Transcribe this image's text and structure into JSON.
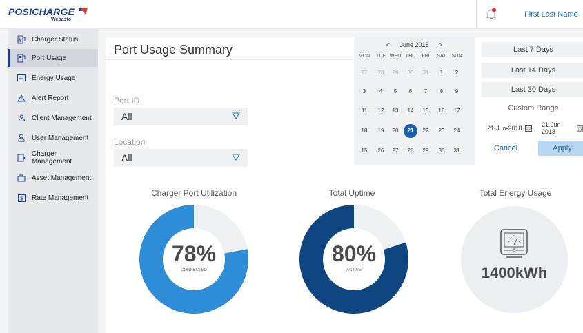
{
  "header": {
    "brand": "POSICHARGE",
    "brand_sub": "Webasto",
    "user_name": "First Last Name",
    "icons": {
      "notifications": "bell-icon"
    }
  },
  "sidebar": {
    "items": [
      {
        "label": "Charger Status",
        "icon": "charger-status-icon"
      },
      {
        "label": "Port Usage",
        "icon": "port-usage-icon",
        "active": true
      },
      {
        "label": "Energy Usage",
        "icon": "energy-usage-icon"
      },
      {
        "label": "Alert Report",
        "icon": "alert-icon"
      },
      {
        "label": "Client Management",
        "icon": "client-icon"
      },
      {
        "label": "User Management",
        "icon": "user-icon"
      },
      {
        "label": "Charger Management",
        "icon": "charger-management-icon"
      },
      {
        "label": "Asset Management",
        "icon": "asset-icon"
      },
      {
        "label": "Rate Management",
        "icon": "rate-icon"
      }
    ]
  },
  "main": {
    "title": "Port Usage Summary",
    "filters": {
      "port_id_label": "Port ID",
      "port_id_value": "All",
      "location_label": "Location",
      "location_value": "All"
    }
  },
  "calendar": {
    "prev": "<",
    "month": "June 2018",
    "next": ">",
    "dow": [
      "MON",
      "TUE",
      "WED",
      "THU",
      "FRI",
      "SAT",
      "SUN"
    ],
    "weeks": [
      [
        "27",
        "28",
        "29",
        "30",
        "31",
        "1",
        "2"
      ],
      [
        "3",
        "4",
        "5",
        "6",
        "7",
        "8",
        "9"
      ],
      [
        "11",
        "12",
        "13",
        "14",
        "15",
        "16",
        "17"
      ],
      [
        "18",
        "19",
        "20",
        "21",
        "22",
        "23",
        "24"
      ],
      [
        "15",
        "26",
        "27",
        "28",
        "29",
        "30",
        "31"
      ]
    ],
    "selected": "21"
  },
  "ranges": {
    "options": [
      "Last 7 Days",
      "Last 14 Days",
      "Last 30 Days"
    ],
    "custom_label": "Custom Range",
    "start_date": "21-Jun-2018",
    "end_date": "21-Jun-2018",
    "cancel": "Cancel",
    "apply": "Apply"
  },
  "gauges": {
    "utilization": {
      "title": "Charger Port Utilization",
      "value": "78%",
      "sub": "CONNECTED",
      "fraction": 0.78,
      "color": "#2e8dd6"
    },
    "uptime": {
      "title": "Total Uptime",
      "value": "80%",
      "sub": "ACTIVE",
      "fraction": 0.8,
      "color": "#0f4580"
    },
    "energy": {
      "title": "Total Energy Usage",
      "value": "1400kWh",
      "icon": "meter-icon"
    }
  },
  "colors": {
    "brand": "#1d3f91",
    "accent": "#1976d2",
    "track": "#eef1f4"
  }
}
